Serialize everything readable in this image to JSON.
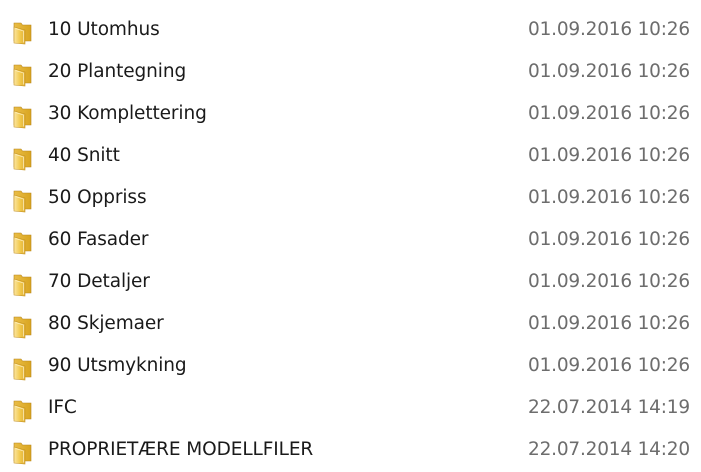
{
  "folder_icon": "folder-icon",
  "colors": {
    "name_text": "#1a1a1a",
    "date_text": "#6d6d6d",
    "folder_front": "#f2c94c",
    "folder_back": "#d9a520"
  },
  "files": [
    {
      "name": "10 Utomhus",
      "modified": "01.09.2016 10:26"
    },
    {
      "name": "20 Plantegning",
      "modified": "01.09.2016 10:26"
    },
    {
      "name": "30 Komplettering",
      "modified": "01.09.2016 10:26"
    },
    {
      "name": "40 Snitt",
      "modified": "01.09.2016 10:26"
    },
    {
      "name": "50 Oppriss",
      "modified": "01.09.2016 10:26"
    },
    {
      "name": "60 Fasader",
      "modified": "01.09.2016 10:26"
    },
    {
      "name": "70 Detaljer",
      "modified": "01.09.2016 10:26"
    },
    {
      "name": "80 Skjemaer",
      "modified": "01.09.2016 10:26"
    },
    {
      "name": "90 Utsmykning",
      "modified": "01.09.2016 10:26"
    },
    {
      "name": "IFC",
      "modified": "22.07.2014 14:19"
    },
    {
      "name": "PROPRIETÆRE MODELLFILER",
      "modified": "22.07.2014 14:20"
    }
  ]
}
